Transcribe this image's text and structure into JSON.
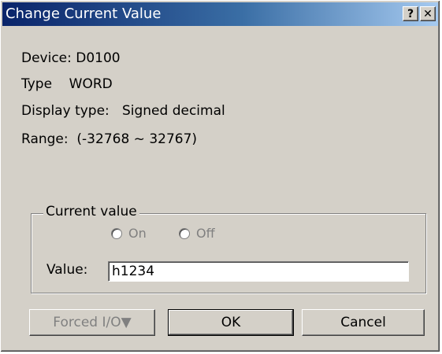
{
  "window": {
    "title": "Change Current Value",
    "help_button": "?",
    "close_button": "✕"
  },
  "info": {
    "device": "Device: D0100",
    "type": "Type    WORD",
    "display_type": "Display type:   Signed decimal",
    "range": "Range:  (-32768 ~ 32767)"
  },
  "current_value_group": {
    "label": "Current value",
    "radio_on": {
      "label": "On",
      "selected": false,
      "enabled": false
    },
    "radio_off": {
      "label": "Off",
      "selected": false,
      "enabled": false
    },
    "value_label": "Value:",
    "value": "h1234"
  },
  "buttons": {
    "forced_io": "Forced I/O▼",
    "ok": "OK",
    "cancel": "Cancel"
  },
  "colors": {
    "face": "#d4d0c8",
    "title_start": "#0a246a",
    "title_end": "#a6caf0",
    "disabled_text": "#808080"
  }
}
